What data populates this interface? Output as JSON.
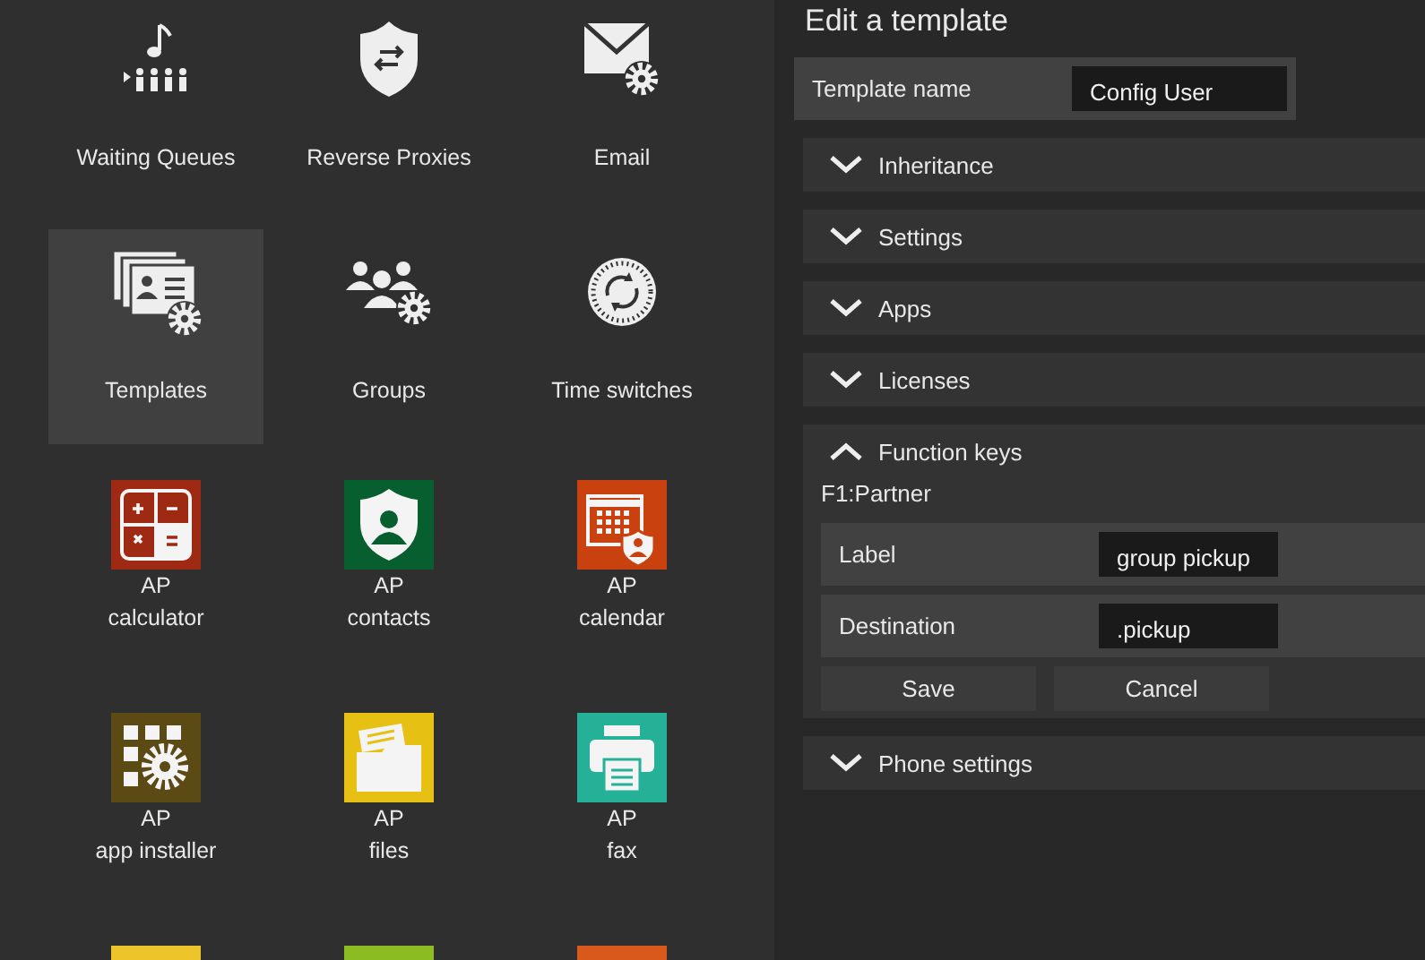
{
  "launcher": {
    "items": [
      {
        "kind": "system",
        "label_lines": [
          "Waiting Queues"
        ],
        "selected": false
      },
      {
        "kind": "system",
        "label_lines": [
          "Reverse Proxies"
        ],
        "selected": false
      },
      {
        "kind": "system",
        "label_lines": [
          "Email"
        ],
        "selected": false
      },
      {
        "kind": "system",
        "label_lines": [
          "Templates"
        ],
        "selected": true
      },
      {
        "kind": "system",
        "label_lines": [
          "Groups"
        ],
        "selected": false
      },
      {
        "kind": "system",
        "label_lines": [
          "Time switches"
        ],
        "selected": false
      },
      {
        "kind": "app",
        "label_lines": [
          "AP",
          "calculator"
        ],
        "color": "#9e2a14",
        "selected": false
      },
      {
        "kind": "app",
        "label_lines": [
          "AP",
          "contacts"
        ],
        "color": "#075e2f",
        "selected": false
      },
      {
        "kind": "app",
        "label_lines": [
          "AP",
          "calendar"
        ],
        "color": "#c8410f",
        "selected": false
      },
      {
        "kind": "app",
        "label_lines": [
          "AP",
          "app installer"
        ],
        "color": "#5b4a14",
        "selected": false
      },
      {
        "kind": "app",
        "label_lines": [
          "AP",
          "files"
        ],
        "color": "#e6c012",
        "selected": false
      },
      {
        "kind": "app",
        "label_lines": [
          "AP",
          "fax"
        ],
        "color": "#25b197",
        "selected": false
      },
      {
        "kind": "app",
        "color": "#edc42a",
        "selected": false
      },
      {
        "kind": "app",
        "color": "#8bbd23",
        "selected": false
      },
      {
        "kind": "app",
        "color": "#d9581c",
        "selected": false
      }
    ]
  },
  "editor": {
    "title": "Edit a template",
    "name_field": {
      "label": "Template name",
      "value": "Config User"
    },
    "sections": [
      {
        "label": "Inheritance",
        "expanded": false
      },
      {
        "label": "Settings",
        "expanded": false
      },
      {
        "label": "Apps",
        "expanded": false
      },
      {
        "label": "Licenses",
        "expanded": false
      },
      {
        "label": "Function keys",
        "expanded": true,
        "key": {
          "title": "F1:Partner",
          "fields": [
            {
              "label": "Label",
              "value": "group pickup"
            },
            {
              "label": "Destination",
              "value": ".pickup"
            }
          ],
          "buttons": [
            "Save",
            "Cancel"
          ]
        }
      },
      {
        "label": "Phone settings",
        "expanded": false
      }
    ]
  }
}
